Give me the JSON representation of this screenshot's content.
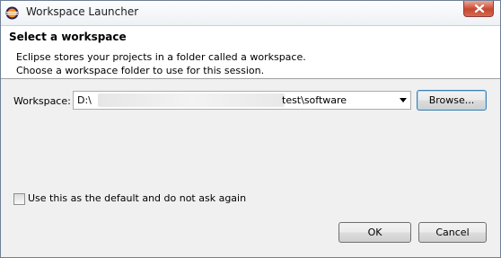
{
  "window": {
    "title": "Workspace Launcher",
    "icon": "eclipse-icon",
    "close_icon": "close-icon"
  },
  "header": {
    "title": "Select a workspace",
    "description_line1": "Eclipse stores your projects in a folder called a workspace.",
    "description_line2": "Choose a workspace folder to use for this session."
  },
  "workspace": {
    "label": "Workspace:",
    "value_prefix": "D:\\",
    "value_suffix": "test\\software",
    "browse_label": "Browse..."
  },
  "default_checkbox": {
    "label": "Use this as the default and do not ask again",
    "checked": false
  },
  "footer": {
    "ok_label": "OK",
    "cancel_label": "Cancel"
  },
  "colors": {
    "accent": "#3c7fb1",
    "close_button": "#c8472f"
  }
}
